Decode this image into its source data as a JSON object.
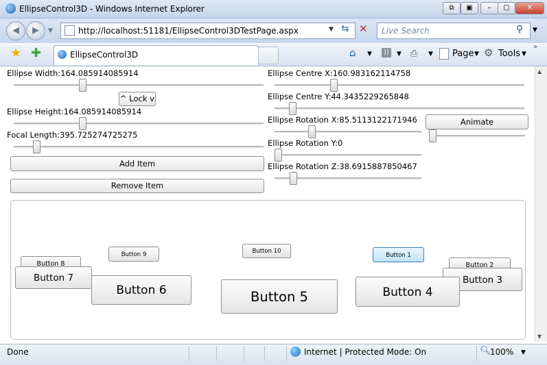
{
  "window": {
    "title": "EllipseControl3D - Windows Internet Explorer",
    "controls": {
      "back": "⧉",
      "min": "–",
      "max": "▢",
      "close": "✕"
    }
  },
  "navbar": {
    "url": "http://localhost:51181/EllipseControl3DTestPage.aspx",
    "search_placeholder": "Live Search"
  },
  "tabbar": {
    "tab_label": "EllipseControl3D",
    "commands": {
      "page": "Page",
      "tools": "Tools"
    }
  },
  "controls": {
    "ellipse_width": {
      "label": "Ellipse Width:164.085914085914",
      "value": 0.27
    },
    "lock_label": "^ Lock v",
    "ellipse_height": {
      "label": "Ellipse Height:164.085914085914",
      "value": 0.27
    },
    "focal_length": {
      "label": "Focal Length:395.725274725275",
      "value": 0.08
    },
    "add_item": "Add Item",
    "remove_item": "Remove Item",
    "centre_x": {
      "label": "Ellipse Centre X:160.983162114758",
      "value": 0.23
    },
    "centre_y": {
      "label": "Ellipse Centre Y:44.3435229265848",
      "value": 0.06
    },
    "rotation_x": {
      "label": "Ellipse Rotation X:85.5113122171946",
      "value": 0.24
    },
    "rotation_y": {
      "label": "Ellipse Rotation Y:0",
      "value": 0.0
    },
    "rotation_z": {
      "label": "Ellipse Rotation Z:38.6915887850467",
      "value": 0.11
    },
    "animate": "Animate",
    "animate_slider": 0.0
  },
  "items": [
    "Button 1",
    "Button 2",
    "Button 3",
    "Button 4",
    "Button 5",
    "Button 6",
    "Button 7",
    "Button 8",
    "Button 9",
    "Button 10"
  ],
  "status": {
    "left": "Done",
    "zone": "Internet | Protected Mode: On",
    "zoom": "100%"
  }
}
